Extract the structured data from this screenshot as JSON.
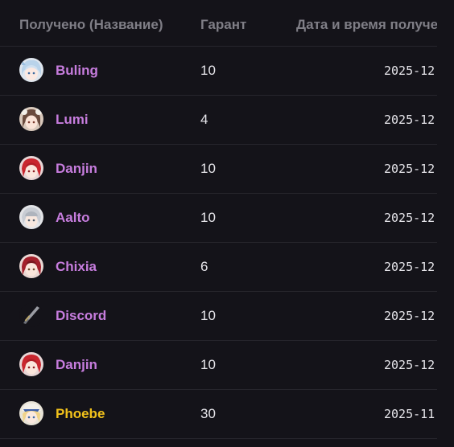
{
  "table": {
    "headers": {
      "name": "Получено (Название)",
      "pity": "Гарант",
      "date": "Дата и время получе"
    },
    "rows": [
      {
        "name": "Buling",
        "pity": "10",
        "date": "2025-12",
        "name_color": "#c77dde",
        "avatar": "buling-avatar-icon"
      },
      {
        "name": "Lumi",
        "pity": "4",
        "date": "2025-12",
        "name_color": "#c77dde",
        "avatar": "lumi-avatar-icon"
      },
      {
        "name": "Danjin",
        "pity": "10",
        "date": "2025-12",
        "name_color": "#c77dde",
        "avatar": "danjin-avatar-icon"
      },
      {
        "name": "Aalto",
        "pity": "10",
        "date": "2025-12",
        "name_color": "#c77dde",
        "avatar": "aalto-avatar-icon"
      },
      {
        "name": "Chixia",
        "pity": "6",
        "date": "2025-12",
        "name_color": "#c77dde",
        "avatar": "chixia-avatar-icon"
      },
      {
        "name": "Discord",
        "pity": "10",
        "date": "2025-12",
        "name_color": "#c77dde",
        "avatar": "discord-weapon-icon"
      },
      {
        "name": "Danjin",
        "pity": "10",
        "date": "2025-12",
        "name_color": "#c77dde",
        "avatar": "danjin-avatar-icon"
      },
      {
        "name": "Phoebe",
        "pity": "30",
        "date": "2025-11",
        "name_color": "#f2c21b",
        "avatar": "phoebe-avatar-icon"
      }
    ]
  },
  "colors": {
    "background": "#141319",
    "header_text": "#7f7e86",
    "body_text": "#e6e5ea",
    "four_star": "#c77dde",
    "five_star": "#f2c21b",
    "divider": "#26252c"
  }
}
